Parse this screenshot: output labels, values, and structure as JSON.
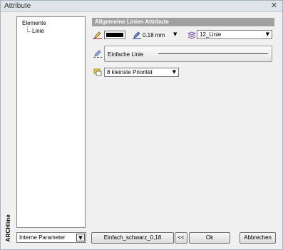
{
  "window": {
    "title": "Attribute",
    "close_glyph": "✕"
  },
  "side_strip": {
    "label": "ARCHline"
  },
  "tree": {
    "root": "Elemente",
    "child": "Linie"
  },
  "group": {
    "header": "Allgemeine Linien Attribute"
  },
  "line_props": {
    "color": "#000000",
    "width_value": "0.18 mm",
    "layer_value": "12_Linie",
    "linestyle_label": "Einfache Linie",
    "priority_value": "8 kleinste Priorität"
  },
  "icons": {
    "color": "pencil-color-icon",
    "width": "pen-width-icon",
    "layer": "layers-icon",
    "style": "pencil-style-icon",
    "priority": "priority-icon"
  },
  "footer": {
    "params_value": "Interne Parameter",
    "preset_label": "Einfach_schwarz_0,18",
    "back_label": "<<",
    "ok_label": "Ok",
    "cancel_label": "Abbrechen"
  }
}
